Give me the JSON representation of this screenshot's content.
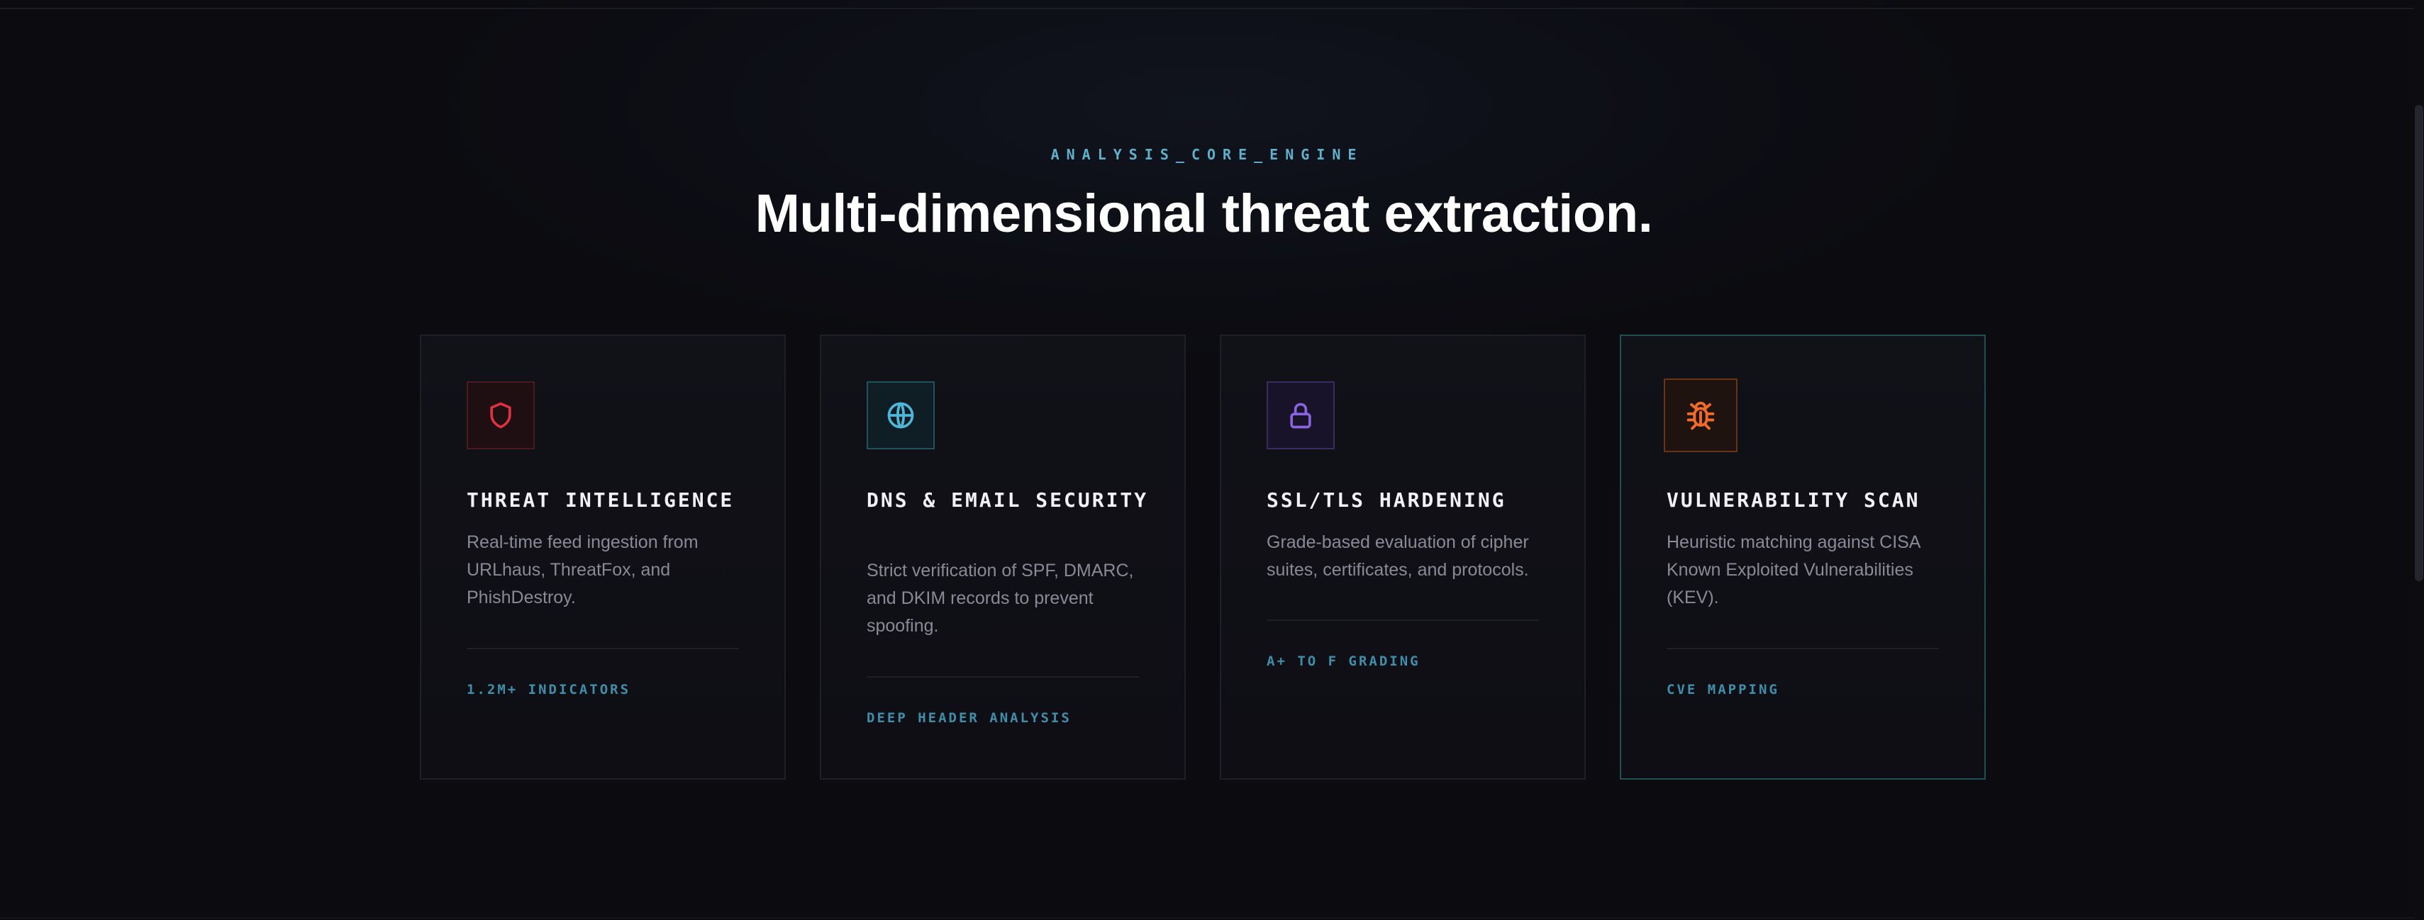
{
  "section": {
    "eyebrow": "ANALYSIS_CORE_ENGINE",
    "headline": "Multi-dimensional threat extraction."
  },
  "cards": [
    {
      "icon": "shield-icon",
      "icon_color": "#e0323c",
      "title": "THREAT INTELLIGENCE",
      "description": "Real-time feed ingestion from URLhaus, ThreatFox, and PhishDestroy.",
      "tag": "1.2M+ INDICATORS"
    },
    {
      "icon": "globe-icon",
      "icon_color": "#4fb6d8",
      "title": "DNS & EMAIL SECURITY",
      "description": "Strict verification of SPF, DMARC, and DKIM records to prevent spoofing.",
      "tag": "DEEP HEADER ANALYSIS"
    },
    {
      "icon": "lock-icon",
      "icon_color": "#8a63e0",
      "title": "SSL/TLS HARDENING",
      "description": "Grade-based evaluation of cipher suites, certificates, and protocols.",
      "tag": "A+ TO F GRADING"
    },
    {
      "icon": "bug-icon",
      "icon_color": "#f06a2a",
      "title": "VULNERABILITY SCAN",
      "description": "Heuristic matching against CISA Known Exploited Vulnerabilities (KEV).",
      "tag": "CVE MAPPING"
    }
  ],
  "colors": {
    "background": "#0b0b10",
    "accent": "#5fb0cc",
    "highlight_border": "#1f4f52"
  }
}
